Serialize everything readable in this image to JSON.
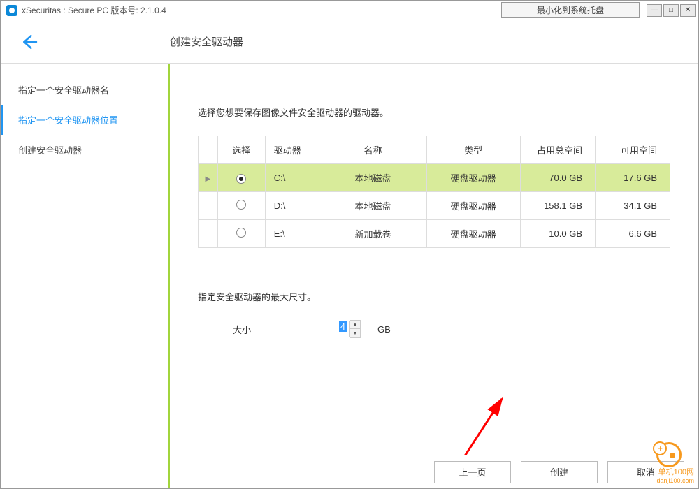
{
  "window": {
    "title": "xSecuritas : Secure PC     版本号: 2.1.0.4",
    "tray_text": "最小化到系统托盘"
  },
  "header": {
    "title": "创建安全驱动器"
  },
  "sidebar": {
    "items": [
      {
        "label": "指定一个安全驱动器名"
      },
      {
        "label": "指定一个安全驱动器位置"
      },
      {
        "label": "创建安全驱动器"
      }
    ]
  },
  "main": {
    "instruction": "选择您想要保存图像文件安全驱动器的驱动器。",
    "columns": {
      "select": "选择",
      "drive": "驱动器",
      "name": "名称",
      "type": "类型",
      "total": "占用总空间",
      "free": "可用空间"
    },
    "rows": [
      {
        "drive": "C:\\",
        "name": "本地磁盘",
        "type": "硬盘驱动器",
        "total": "70.0 GB",
        "free": "17.6 GB",
        "selected": true
      },
      {
        "drive": "D:\\",
        "name": "本地磁盘",
        "type": "硬盘驱动器",
        "total": "158.1 GB",
        "free": "34.1 GB",
        "selected": false
      },
      {
        "drive": "E:\\",
        "name": "新加载卷",
        "type": "硬盘驱动器",
        "total": "10.0 GB",
        "free": "6.6 GB",
        "selected": false
      }
    ],
    "size_section": {
      "label": "指定安全驱动器的最大尺寸。",
      "caption": "大小",
      "value": "4",
      "unit": "GB"
    }
  },
  "footer": {
    "prev": "上一页",
    "create": "创建",
    "cancel": "取消"
  },
  "watermark": {
    "line1": "单机100网",
    "line2": "danji100.com"
  }
}
